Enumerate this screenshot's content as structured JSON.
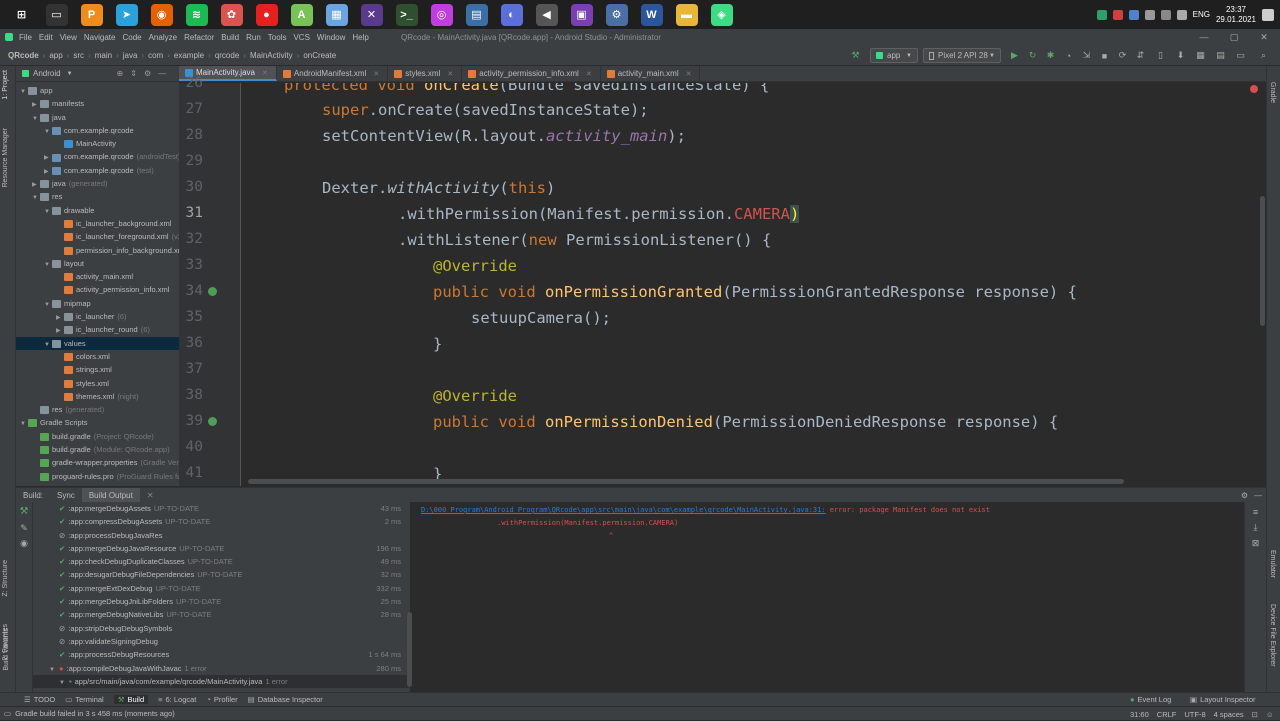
{
  "taskbar": {
    "apps": [
      {
        "name": "start-icon",
        "color": "#1f1f1f",
        "glyph": "⊞"
      },
      {
        "name": "terminal-icon",
        "color": "#333333",
        "glyph": "▭"
      },
      {
        "name": "search-app-icon",
        "color": "#f08c1a",
        "glyph": "P"
      },
      {
        "name": "telegram-icon",
        "color": "#2aa1da",
        "glyph": "➤"
      },
      {
        "name": "firefox-icon",
        "color": "#e66000",
        "glyph": "◉"
      },
      {
        "name": "spotify-icon",
        "color": "#1db954",
        "glyph": "≋"
      },
      {
        "name": "paint-icon",
        "color": "#d9534f",
        "glyph": "✿"
      },
      {
        "name": "record-icon",
        "color": "#e52020",
        "glyph": "●"
      },
      {
        "name": "android-icon",
        "color": "#78c257",
        "glyph": "A"
      },
      {
        "name": "photos-icon",
        "color": "#6aa5e0",
        "glyph": "▦"
      },
      {
        "name": "tools-icon",
        "color": "#5a3a8a",
        "glyph": "✕"
      },
      {
        "name": "console-icon",
        "color": "#2f4f2f",
        "glyph": ">_"
      },
      {
        "name": "color-app-icon",
        "color": "#c03de0",
        "glyph": "◎"
      },
      {
        "name": "calculator-icon",
        "color": "#3a6ea5",
        "glyph": "▤"
      },
      {
        "name": "browser-icon",
        "color": "#5b6fd8",
        "glyph": "◐"
      },
      {
        "name": "volume-app-icon",
        "color": "#555555",
        "glyph": "◀"
      },
      {
        "name": "media-icon",
        "color": "#7a3fb0",
        "glyph": "▣"
      },
      {
        "name": "settings-app-icon",
        "color": "#4a6fa5",
        "glyph": "⚙"
      },
      {
        "name": "word-icon",
        "color": "#2b579a",
        "glyph": "W"
      },
      {
        "name": "explorer-icon",
        "color": "#e8b73a",
        "glyph": "▬"
      },
      {
        "name": "android-studio-icon",
        "color": "#3ddc84",
        "glyph": "◈"
      }
    ],
    "lang": "ENG",
    "time": "23:37",
    "date": "29.01.2021"
  },
  "menu": {
    "items": [
      "File",
      "Edit",
      "View",
      "Navigate",
      "Code",
      "Analyze",
      "Refactor",
      "Build",
      "Run",
      "Tools",
      "VCS",
      "Window",
      "Help"
    ],
    "title": "QRcode - MainActivity.java [QRcode.app] - Android Studio - Administrator"
  },
  "breadcrumb": [
    "QRcode",
    "app",
    "src",
    "main",
    "java",
    "com",
    "example",
    "qrcode",
    "MainActivity",
    "onCreate"
  ],
  "run_config": "app",
  "device": "Pixel 2 API 28",
  "project_panel": {
    "view": "Android",
    "rows": [
      {
        "indent": 0,
        "arrow": "▼",
        "icon": "fold",
        "label": "app",
        "hint": ""
      },
      {
        "indent": 1,
        "arrow": "▶",
        "icon": "fold",
        "label": "manifests",
        "hint": ""
      },
      {
        "indent": 1,
        "arrow": "▼",
        "icon": "fold",
        "label": "java",
        "hint": ""
      },
      {
        "indent": 2,
        "arrow": "▼",
        "icon": "fold-blue",
        "label": "com.example.qrcode",
        "hint": ""
      },
      {
        "indent": 3,
        "arrow": "",
        "icon": "file-java",
        "label": "MainActivity",
        "hint": ""
      },
      {
        "indent": 2,
        "arrow": "▶",
        "icon": "fold-blue",
        "label": "com.example.qrcode",
        "hint": "(androidTest)"
      },
      {
        "indent": 2,
        "arrow": "▶",
        "icon": "fold-blue",
        "label": "com.example.qrcode",
        "hint": "(test)"
      },
      {
        "indent": 1,
        "arrow": "▶",
        "icon": "fold",
        "label": "java",
        "hint": "(generated)"
      },
      {
        "indent": 1,
        "arrow": "▼",
        "icon": "fold",
        "label": "res",
        "hint": ""
      },
      {
        "indent": 2,
        "arrow": "▼",
        "icon": "fold",
        "label": "drawable",
        "hint": ""
      },
      {
        "indent": 3,
        "arrow": "",
        "icon": "file-xml",
        "label": "ic_launcher_background.xml",
        "hint": ""
      },
      {
        "indent": 3,
        "arrow": "",
        "icon": "file-xml",
        "label": "ic_launcher_foreground.xml",
        "hint": "(v24)"
      },
      {
        "indent": 3,
        "arrow": "",
        "icon": "file-xml",
        "label": "permission_info_background.xml",
        "hint": ""
      },
      {
        "indent": 2,
        "arrow": "▼",
        "icon": "fold",
        "label": "layout",
        "hint": ""
      },
      {
        "indent": 3,
        "arrow": "",
        "icon": "file-xml",
        "label": "activity_main.xml",
        "hint": ""
      },
      {
        "indent": 3,
        "arrow": "",
        "icon": "file-xml",
        "label": "activity_permission_info.xml",
        "hint": ""
      },
      {
        "indent": 2,
        "arrow": "▼",
        "icon": "fold",
        "label": "mipmap",
        "hint": ""
      },
      {
        "indent": 3,
        "arrow": "▶",
        "icon": "fold",
        "label": "ic_launcher",
        "hint": "(6)"
      },
      {
        "indent": 3,
        "arrow": "▶",
        "icon": "fold",
        "label": "ic_launcher_round",
        "hint": "(6)"
      },
      {
        "indent": 2,
        "arrow": "▼",
        "icon": "fold",
        "label": "values",
        "hint": "",
        "selected": true
      },
      {
        "indent": 3,
        "arrow": "",
        "icon": "file-xml",
        "label": "colors.xml",
        "hint": ""
      },
      {
        "indent": 3,
        "arrow": "",
        "icon": "file-xml",
        "label": "strings.xml",
        "hint": ""
      },
      {
        "indent": 3,
        "arrow": "",
        "icon": "file-xml",
        "label": "styles.xml",
        "hint": ""
      },
      {
        "indent": 3,
        "arrow": "",
        "icon": "file-xml",
        "label": "themes.xml",
        "hint": "(night)"
      },
      {
        "indent": 1,
        "arrow": "",
        "icon": "fold",
        "label": "res",
        "hint": "(generated)"
      },
      {
        "indent": 0,
        "arrow": "▼",
        "icon": "file-gradle",
        "label": "Gradle Scripts",
        "hint": ""
      },
      {
        "indent": 1,
        "arrow": "",
        "icon": "file-gradle",
        "label": "build.gradle",
        "hint": "(Project: QRcode)"
      },
      {
        "indent": 1,
        "arrow": "",
        "icon": "file-gradle",
        "label": "build.gradle",
        "hint": "(Module: QRcode.app)"
      },
      {
        "indent": 1,
        "arrow": "",
        "icon": "file-gradle",
        "label": "gradle-wrapper.properties",
        "hint": "(Gradle Version)"
      },
      {
        "indent": 1,
        "arrow": "",
        "icon": "file-gradle",
        "label": "proguard-rules.pro",
        "hint": "(ProGuard Rules for QRcode.app)"
      }
    ]
  },
  "editor": {
    "tabs": [
      {
        "label": "MainActivity.java",
        "icon": "file-java",
        "active": true
      },
      {
        "label": "AndroidManifest.xml",
        "icon": "file-xml",
        "active": false
      },
      {
        "label": "styles.xml",
        "icon": "file-xml",
        "active": false
      },
      {
        "label": "activity_permission_info.xml",
        "icon": "file-xml",
        "active": false
      },
      {
        "label": "activity_main.xml",
        "icon": "file-xml",
        "active": false
      }
    ],
    "line_numbers": [
      "26",
      "27",
      "28",
      "29",
      "30",
      "31",
      "32",
      "33",
      "34",
      "35",
      "36",
      "37",
      "38",
      "39",
      "40",
      "41"
    ],
    "current_line": "31",
    "code": {
      "l26a": "protected ",
      "l26b": "void ",
      "l26c": "onCreate",
      "l26d": "(Bundle savedInstanceState) {",
      "l27a": "super",
      "l27b": ".onCreate(savedInstanceState);",
      "l28a": "setContentView(R.layout.",
      "l28b": "activity_main",
      "l28c": ");",
      "l30a": "Dexter.",
      "l30b": "withActivity",
      "l30c": "(",
      "l30d": "this",
      "l30e": ")",
      "l31a": ".withPermission(Manifest.permission.",
      "l31b": "CAMERA",
      "l31c": ")",
      "l32a": ".withListener(",
      "l32b": "new ",
      "l32c": "PermissionListener() {",
      "l33a": "@Override",
      "l34a": "public ",
      "l34b": "void ",
      "l34c": "onPermissionGranted",
      "l34d": "(PermissionGrantedResponse response) {",
      "l35a": "setuupCamera();",
      "l36a": "}",
      "l38a": "@Override",
      "l39a": "public ",
      "l39b": "void ",
      "l39c": "onPermissionDenied",
      "l39d": "(PermissionDeniedResponse response) {",
      "l41a": "}"
    }
  },
  "build": {
    "tabs": [
      "Build:",
      "Sync",
      "Build Output"
    ],
    "rows": [
      {
        "status": "ok",
        "task": ":app:mergeDebugAssets",
        "state": "UP-TO-DATE",
        "ms": "43 ms",
        "indent": 2
      },
      {
        "status": "ok",
        "task": ":app:compressDebugAssets",
        "state": "UP-TO-DATE",
        "ms": "2 ms",
        "indent": 2
      },
      {
        "status": "skip",
        "task": ":app:processDebugJavaRes",
        "state": "",
        "ms": "",
        "indent": 2
      },
      {
        "status": "ok",
        "task": ":app:mergeDebugJavaResource",
        "state": "UP-TO-DATE",
        "ms": "196 ms",
        "indent": 2
      },
      {
        "status": "ok",
        "task": ":app:checkDebugDuplicateClasses",
        "state": "UP-TO-DATE",
        "ms": "49 ms",
        "indent": 2
      },
      {
        "status": "ok",
        "task": ":app:desugarDebugFileDependencies",
        "state": "UP-TO-DATE",
        "ms": "32 ms",
        "indent": 2
      },
      {
        "status": "ok",
        "task": ":app:mergeExtDexDebug",
        "state": "UP-TO-DATE",
        "ms": "332 ms",
        "indent": 2
      },
      {
        "status": "ok",
        "task": ":app:mergeDebugJniLibFolders",
        "state": "UP-TO-DATE",
        "ms": "25 ms",
        "indent": 2
      },
      {
        "status": "ok",
        "task": ":app:mergeDebugNativeLibs",
        "state": "UP-TO-DATE",
        "ms": "28 ms",
        "indent": 2
      },
      {
        "status": "skip",
        "task": ":app:stripDebugDebugSymbols",
        "state": "",
        "ms": "",
        "indent": 2
      },
      {
        "status": "skip",
        "task": ":app:validateSigningDebug",
        "state": "",
        "ms": "",
        "indent": 2
      },
      {
        "status": "ok",
        "task": ":app:processDebugResources",
        "state": "",
        "ms": "1 s 64 ms",
        "indent": 2
      },
      {
        "status": "err",
        "task": ":app:compileDebugJavaWithJavac",
        "state": "1 error",
        "ms": "280 ms",
        "indent": 1
      },
      {
        "status": "errfile",
        "task": "app/src/main/java/com/example/qrcode/MainActivity.java",
        "state": "1 error",
        "ms": "",
        "indent": 2
      }
    ],
    "output": {
      "path": "D:\\000 Program\\Android Program\\QRcode\\app\\src\\main\\java\\com\\example\\qrcode\\MainActivity.java:31:",
      "error": " error: package Manifest does not exist",
      "code_line": ".withPermission(Manifest.permission.CAMERA)",
      "caret": "^"
    }
  },
  "left_stripe": [
    "1: Project",
    "Resource Manager",
    "Z: Structure",
    "2: Favorites",
    "Build Variants"
  ],
  "right_stripe": [
    "Gradle",
    "Emulator",
    "Device File Explorer"
  ],
  "bottom_tabs": [
    "TODO",
    "Terminal",
    "Build",
    "6: Logcat",
    "Profiler",
    "Database Inspector"
  ],
  "bottom_right_tabs": [
    "Event Log",
    "Layout Inspector"
  ],
  "status": {
    "message": "Gradle build failed in 3 s 458 ms (moments ago)",
    "position": "31:60",
    "line_sep": "CRLF",
    "encoding": "UTF-8",
    "indent": "4 spaces"
  }
}
